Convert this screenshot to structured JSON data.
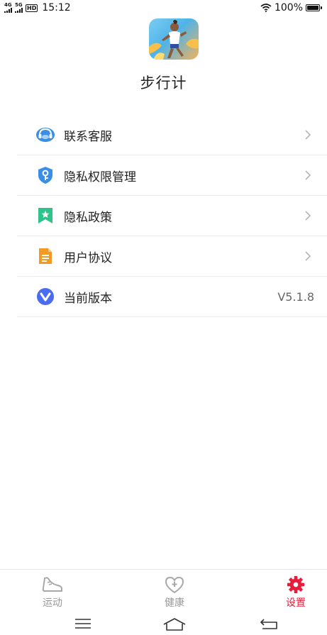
{
  "status_bar": {
    "net1": "4G",
    "net2": "5G",
    "hd_badge": "HD",
    "time": "15:12",
    "battery": "100%",
    "battery_level": 1.0
  },
  "app": {
    "name": "步行计"
  },
  "menu": [
    {
      "label": "联系客服",
      "icon": "headset-icon",
      "color": "#3a8ee6"
    },
    {
      "label": "隐私权限管理",
      "icon": "shield-key-icon",
      "color": "#3a8ee6"
    },
    {
      "label": "隐私政策",
      "icon": "bookmark-star-icon",
      "color": "#2fc28a"
    },
    {
      "label": "用户协议",
      "icon": "document-icon",
      "color": "#f39a25"
    },
    {
      "label": "当前版本",
      "icon": "version-v-icon",
      "color": "#4a6cf0",
      "value": "V5.1.8"
    }
  ],
  "tabs": [
    {
      "label": "运动",
      "icon": "shoe-icon",
      "active": false
    },
    {
      "label": "健康",
      "icon": "heart-plus-icon",
      "active": false
    },
    {
      "label": "设置",
      "icon": "gear-icon",
      "active": true
    }
  ],
  "colors": {
    "accent": "#e61e3c",
    "inactive": "#9a9a9a"
  }
}
